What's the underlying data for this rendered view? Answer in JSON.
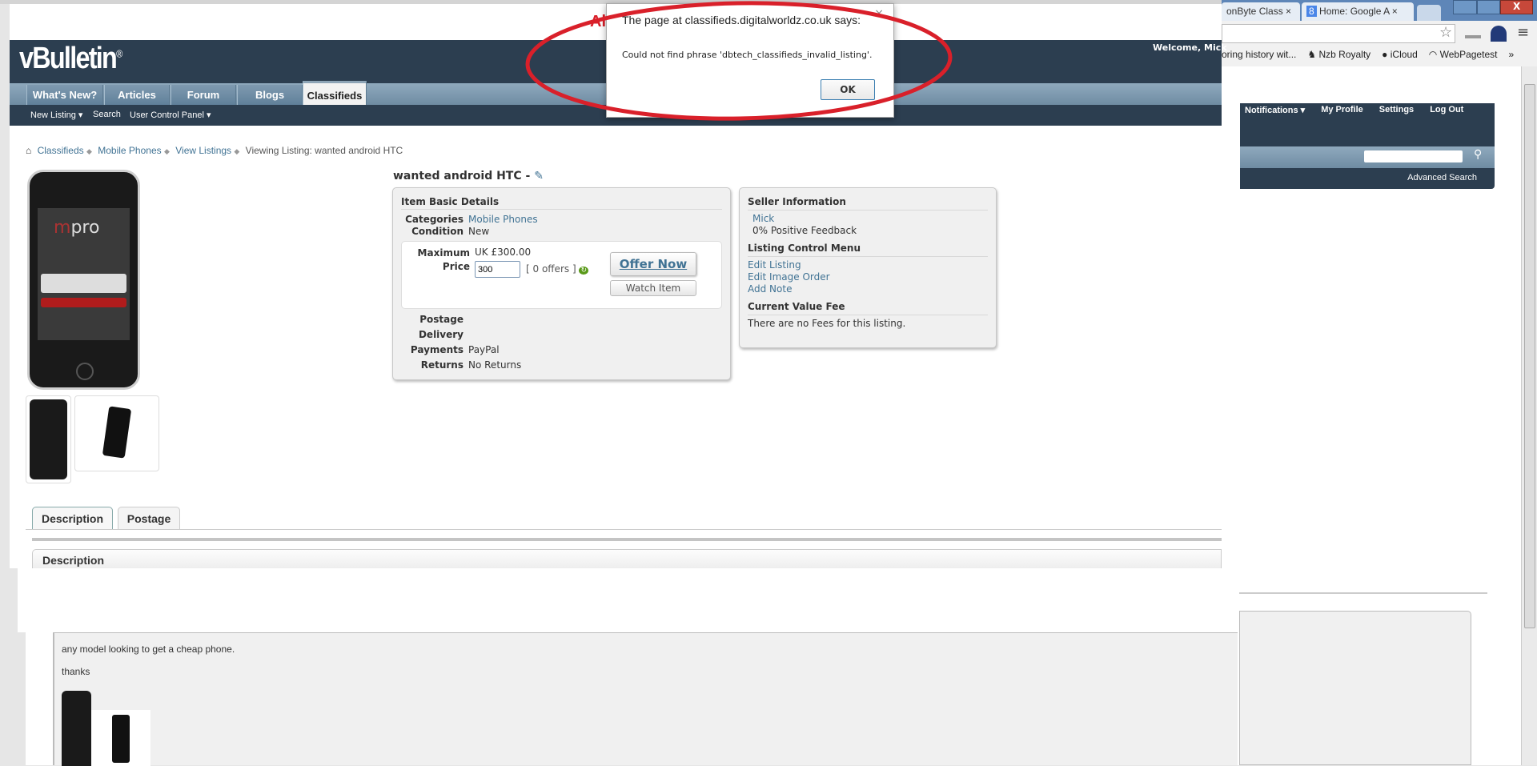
{
  "browser": {
    "tabs": [
      {
        "label": "onByte Class"
      },
      {
        "label": "Home: Google A"
      }
    ],
    "bookmarks": [
      {
        "label": "oring history wit..."
      },
      {
        "label": "Nzb Royalty"
      },
      {
        "label": "iCloud"
      },
      {
        "label": "WebPagetest"
      },
      {
        "label": "»"
      }
    ]
  },
  "site": {
    "logo": "vBulletin",
    "logo_mark": "®",
    "overlay_text": "Al",
    "welcome": "Welcome,",
    "username": "Mick",
    "nav_tabs": [
      {
        "label": "What's New?"
      },
      {
        "label": "Articles"
      },
      {
        "label": "Forum"
      },
      {
        "label": "Blogs"
      },
      {
        "label": "Classifieds"
      }
    ],
    "subnav": [
      {
        "label": "New Listing ▾"
      },
      {
        "label": "Search"
      },
      {
        "label": "User Control Panel ▾"
      }
    ],
    "user_links": [
      {
        "label": "Notifications ▾"
      },
      {
        "label": "My Profile"
      },
      {
        "label": "Settings"
      },
      {
        "label": "Log Out"
      }
    ],
    "search_placeholder": "",
    "advanced_search": "Advanced Search"
  },
  "breadcrumb": [
    {
      "label": "Classifieds"
    },
    {
      "label": "Mobile Phones"
    },
    {
      "label": "View Listings"
    },
    {
      "label": "Viewing Listing: wanted android HTC"
    }
  ],
  "listing": {
    "title": "wanted android HTC -",
    "basic": {
      "heading": "Item Basic Details",
      "categories_label": "Categories",
      "categories": "Mobile Phones",
      "condition_label": "Condition",
      "condition": "New",
      "price_label": "Maximum Price",
      "price": "UK £300.00",
      "offer_value": "300",
      "offers": "[ 0 offers ]",
      "offer_button": "Offer Now",
      "watch_button": "Watch Item",
      "postage_label": "Postage",
      "postage": "",
      "delivery_label": "Delivery",
      "delivery": "",
      "payments_label": "Payments",
      "payments": "PayPal",
      "returns_label": "Returns",
      "returns": "No Returns"
    },
    "seller": {
      "heading": "Seller Information",
      "name": "Mick",
      "feedback": "0% Positive Feedback",
      "control_heading": "Listing Control Menu",
      "controls": [
        {
          "label": "Edit Listing"
        },
        {
          "label": "Edit Image Order"
        },
        {
          "label": "Add Note"
        }
      ],
      "fee_heading": "Current Value Fee",
      "fee_text": "There are no Fees for this listing."
    },
    "tabs": [
      {
        "label": "Description"
      },
      {
        "label": "Postage"
      }
    ],
    "description_heading": "Description",
    "description_lines": [
      "any model looking to get a cheap phone.",
      "thanks"
    ]
  },
  "dialog": {
    "title": "The page at classifieds.digitalworldz.co.uk says:",
    "message": "Could not find phrase 'dbtech_classifieds_invalid_listing'.",
    "ok": "OK",
    "close": "×"
  },
  "colors": {
    "header": "#2c3e50",
    "link": "#417394",
    "annotation": "#d9202a"
  }
}
